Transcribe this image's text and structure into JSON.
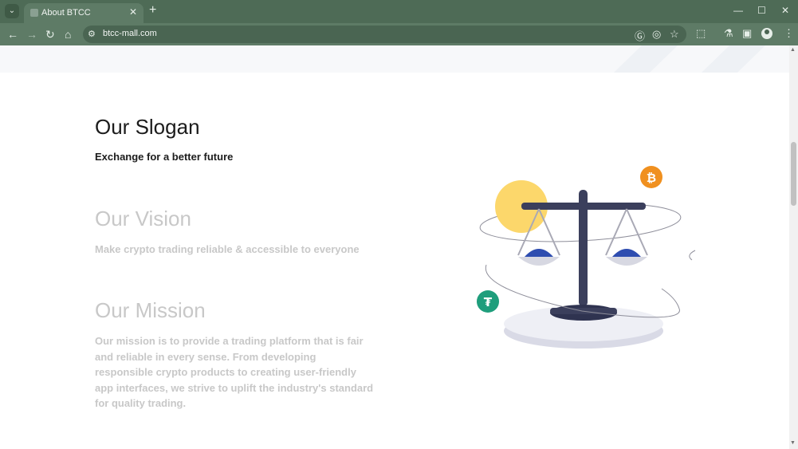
{
  "browser": {
    "tab_title": "About BTCC",
    "url": "btcc-mall.com"
  },
  "content": {
    "slogan_title": "Our Slogan",
    "slogan_text": "Exchange for a better future",
    "vision_title": "Our Vision",
    "vision_text": "Make crypto trading reliable & accessible to everyone",
    "mission_title": "Our Mission",
    "mission_text": "Our mission is to provide a trading platform that is fair and reliable in every sense. From developing responsible crypto products to creating user-friendly app interfaces, we strive to uplift the industry's standard for quality trading."
  },
  "icons": {
    "bitcoin_symbol": "₿",
    "tether_symbol": "₮"
  },
  "colors": {
    "chrome": "#4e6b56",
    "bitcoin": "#f0901f",
    "tether": "#1f9e7c",
    "sun": "#fcd76b",
    "scale": "#3b3f5c"
  }
}
